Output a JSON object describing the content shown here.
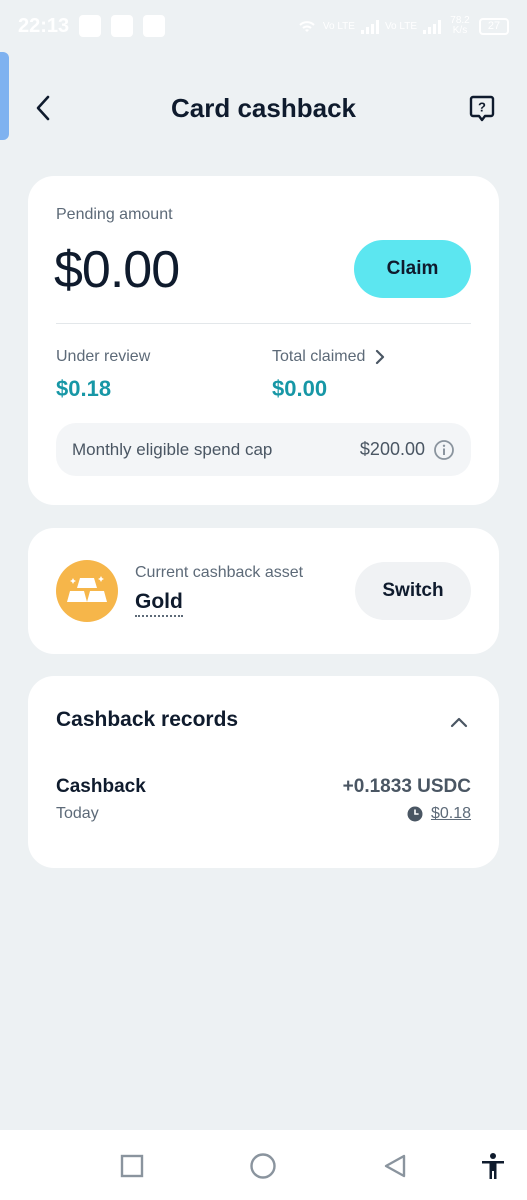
{
  "status_bar": {
    "time": "22:13",
    "net_speed": "78.2 K/s",
    "battery": "27",
    "carrier_1": "Vo LTE",
    "carrier_2": "Vo LTE"
  },
  "header": {
    "title": "Card cashback",
    "back_icon": "chevron-left-icon",
    "help_icon": "help-bubble-icon"
  },
  "pending": {
    "label": "Pending amount",
    "amount": "$0.00",
    "claim_label": "Claim",
    "under_review_label": "Under review",
    "under_review_value": "$0.18",
    "total_claimed_label": "Total claimed",
    "total_claimed_value": "$0.00",
    "spend_cap_label": "Monthly eligible spend cap",
    "spend_cap_value": "$200.00"
  },
  "asset": {
    "label": "Current cashback asset",
    "name": "Gold",
    "switch_label": "Switch"
  },
  "records": {
    "title": "Cashback records",
    "items": [
      {
        "name": "Cashback",
        "date": "Today",
        "amount": "+0.1833 USDC",
        "fiat": "$0.18"
      }
    ]
  },
  "colors": {
    "background": "#edf1f3",
    "accent_cyan": "#5ce6f0",
    "value_teal": "#1797a6",
    "gold": "#f6b64a"
  }
}
